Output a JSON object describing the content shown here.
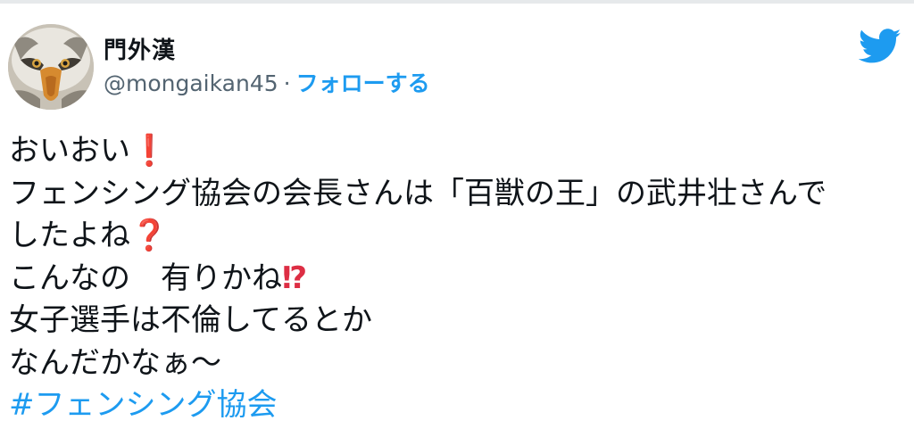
{
  "tweet": {
    "author_name": "門外漢",
    "author_handle": "@mongaikan45",
    "separator": "·",
    "follow_label": "フォローする",
    "lines": [
      {
        "text": "おいおい",
        "emoji": "❗"
      },
      {
        "text": "フェンシング協会の会長さんは「百獣の王」の武井壮さんで"
      },
      {
        "text": "したよね",
        "emoji": "❓"
      },
      {
        "text": "こんなの　有りかね",
        "emoji": "⁉"
      },
      {
        "text": "女子選手は不倫してるとか"
      },
      {
        "text": "なんだかなぁ～"
      }
    ],
    "hashtag": "#フェンシング協会"
  },
  "icons": {
    "avatar": "eagle-avatar",
    "brand": "twitter-bird-icon"
  },
  "colors": {
    "link": "#1d9bf0",
    "secondary_text": "#536471",
    "emoji_red": "#dd2e44"
  }
}
